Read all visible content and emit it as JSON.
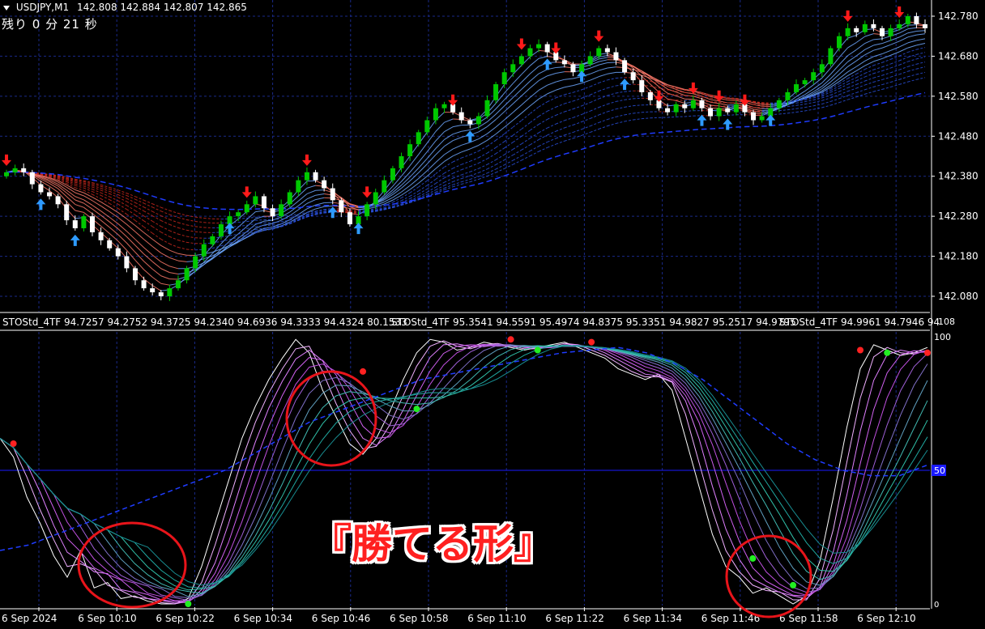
{
  "header": {
    "symbol": "USDJPY,M1",
    "ohlc": "142.808 142.884 142.807 142.865",
    "countdown": "残り 0 分 21 秒"
  },
  "indicator": {
    "labels": [
      "STOStd_4TF 94.7257 94.2752 94.3725 94.2340 94.6936 94.3333 94.4324 80.1533",
      "STOStd_4TF 95.3541 94.5591 95.4974 94.8375 95.3351 94.9827 95.2517 94.9795",
      "STOStd_4TF 94.9961 94.7946 94"
    ],
    "scale_max": "108",
    "level_top": "100",
    "level_mid": "50",
    "level_bottom": "0"
  },
  "banner": "『勝てる形』",
  "chart_data": [
    {
      "type": "candlestick",
      "symbol": "USDJPY",
      "timeframe": "M1",
      "ylim": [
        142.05,
        142.8
      ],
      "y_ticks": [
        "142.780",
        "142.680",
        "142.580",
        "142.480",
        "142.380",
        "142.280",
        "142.180",
        "142.080"
      ],
      "close_series": [
        142.39,
        142.4,
        142.39,
        142.36,
        142.34,
        142.33,
        142.31,
        142.27,
        142.25,
        142.28,
        142.24,
        142.22,
        142.2,
        142.18,
        142.15,
        142.12,
        142.1,
        142.09,
        142.08,
        142.1,
        142.12,
        142.15,
        142.18,
        142.21,
        142.23,
        142.26,
        142.28,
        142.29,
        142.31,
        142.33,
        142.3,
        142.28,
        142.31,
        142.34,
        142.37,
        142.39,
        142.37,
        142.35,
        142.32,
        142.29,
        142.26,
        142.28,
        142.31,
        142.34,
        142.37,
        142.4,
        142.43,
        142.46,
        142.49,
        142.52,
        142.55,
        142.56,
        142.54,
        142.52,
        142.51,
        142.53,
        142.57,
        142.61,
        142.64,
        142.66,
        142.68,
        142.7,
        142.71,
        142.69,
        142.67,
        142.66,
        142.64,
        142.66,
        142.68,
        142.7,
        142.69,
        142.67,
        142.64,
        142.62,
        142.59,
        142.57,
        142.55,
        142.54,
        142.56,
        142.55,
        142.57,
        142.55,
        142.53,
        142.55,
        142.54,
        142.56,
        142.54,
        142.52,
        142.53,
        142.55,
        142.57,
        142.59,
        142.61,
        142.62,
        142.64,
        142.66,
        142.7,
        142.73,
        142.75,
        142.74,
        142.76,
        142.75,
        142.73,
        142.75,
        142.76,
        142.78,
        142.76,
        142.75
      ],
      "buy_arrow_indices": [
        4,
        8,
        26,
        38,
        41,
        54,
        63,
        67,
        72,
        81,
        84,
        89
      ],
      "sell_arrow_indices": [
        0,
        28,
        35,
        42,
        52,
        60,
        64,
        69,
        76,
        80,
        83,
        86,
        98,
        104
      ]
    },
    {
      "type": "line",
      "name": "STOStd_4TF",
      "ylim": [
        0,
        100
      ],
      "x_ticks": [
        "6 Sep 2024",
        "6 Sep 10:10",
        "6 Sep 10:22",
        "6 Sep 10:34",
        "6 Sep 10:46",
        "6 Sep 10:58",
        "6 Sep 11:10",
        "6 Sep 11:22",
        "6 Sep 11:34",
        "6 Sep 11:46",
        "6 Sep 11:58",
        "6 Sep 12:10"
      ],
      "levels": [
        0,
        50,
        100
      ],
      "fast_series": [
        62,
        55,
        40,
        30,
        18,
        10,
        20,
        6,
        8,
        2,
        3,
        1,
        0,
        0,
        2,
        14,
        30,
        46,
        62,
        74,
        84,
        92,
        99,
        94,
        80,
        70,
        60,
        56,
        62,
        72,
        84,
        94,
        99,
        98,
        95,
        96,
        98,
        97,
        96,
        95,
        96,
        97,
        98,
        96,
        94,
        92,
        88,
        86,
        84,
        86,
        80,
        62,
        44,
        26,
        14,
        10,
        4,
        6,
        3,
        0,
        3,
        16,
        40,
        66,
        88,
        97,
        95,
        93,
        94,
        96
      ],
      "slow_series": [
        20,
        22,
        26,
        30,
        34,
        38,
        42,
        46,
        50,
        56,
        62,
        68,
        72,
        76,
        80,
        84,
        86,
        88,
        90,
        92,
        94,
        95,
        96,
        94,
        90,
        84,
        76,
        68,
        60,
        54,
        50,
        48,
        48,
        52
      ],
      "signals": [
        {
          "color": "red",
          "x_index": 1,
          "value": 60
        },
        {
          "color": "green",
          "x_index": 14,
          "value": 0
        },
        {
          "color": "red",
          "x_index": 27,
          "value": 87
        },
        {
          "color": "green",
          "x_index": 31,
          "value": 73
        },
        {
          "color": "red",
          "x_index": 38,
          "value": 99
        },
        {
          "color": "green",
          "x_index": 40,
          "value": 95
        },
        {
          "color": "red",
          "x_index": 44,
          "value": 98
        },
        {
          "color": "green",
          "x_index": 56,
          "value": 17
        },
        {
          "color": "green",
          "x_index": 59,
          "value": 7
        },
        {
          "color": "red",
          "x_index": 64,
          "value": 95
        },
        {
          "color": "green",
          "x_index": 66,
          "value": 94
        },
        {
          "color": "red",
          "x_index": 69,
          "value": 94
        }
      ]
    }
  ],
  "colors": {
    "background": "#000000",
    "bull_candle": "#00c800",
    "bear_candle": "#ffffff",
    "sell_arrow": "#ff1a1a",
    "buy_arrow": "#2e9bff",
    "grid": "#1a2a8a",
    "highlight_circle": "#e8141a",
    "banner": "#ff2020"
  }
}
